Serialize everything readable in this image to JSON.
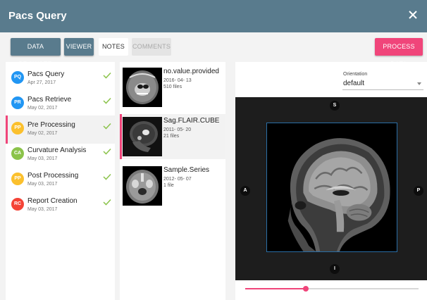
{
  "app": {
    "title": "Pacs Query"
  },
  "toolbar": {
    "data_browser": "DATA BROWSER",
    "viewer": "VIEWER",
    "notes": "NOTES",
    "comments": "COMMENTS",
    "process_data": "PROCESS DATA"
  },
  "steps": [
    {
      "initials": "PQ",
      "name": "Pacs Query",
      "date": "Apr 27, 2017",
      "color": "#2196f3"
    },
    {
      "initials": "PR",
      "name": "Pacs Retrieve",
      "date": "May 02, 2017",
      "color": "#2196f3"
    },
    {
      "initials": "PP",
      "name": "Pre Processing",
      "date": "May 02, 2017",
      "color": "#fbc02d"
    },
    {
      "initials": "CA",
      "name": "Curvature Analysis",
      "date": "May 03, 2017",
      "color": "#8bc34a"
    },
    {
      "initials": "PP",
      "name": "Post Processing",
      "date": "May 03, 2017",
      "color": "#fbc02d"
    },
    {
      "initials": "RC",
      "name": "Report Creation",
      "date": "May 03, 2017",
      "color": "#f44336"
    }
  ],
  "files": [
    {
      "name": "no.value.provided",
      "date": "2016- 04- 13",
      "count": "510 files"
    },
    {
      "name": "Sag.FLAIR.CUBE",
      "date": "2011- 05- 20",
      "count": "21 files"
    },
    {
      "name": "Sample.Series",
      "date": "2012- 05- 07",
      "count": "1 file"
    }
  ],
  "viewer": {
    "orientation_label": "Orientation",
    "orientation_value": "default",
    "markers": {
      "top": "S",
      "left": "A",
      "right": "P",
      "bottom": "I"
    },
    "slice_fraction": 0.35
  },
  "colors": {
    "header": "#597b8d",
    "accent": "#f0457a",
    "check": "#8bc34a",
    "viewport": "#1d1d1d"
  }
}
